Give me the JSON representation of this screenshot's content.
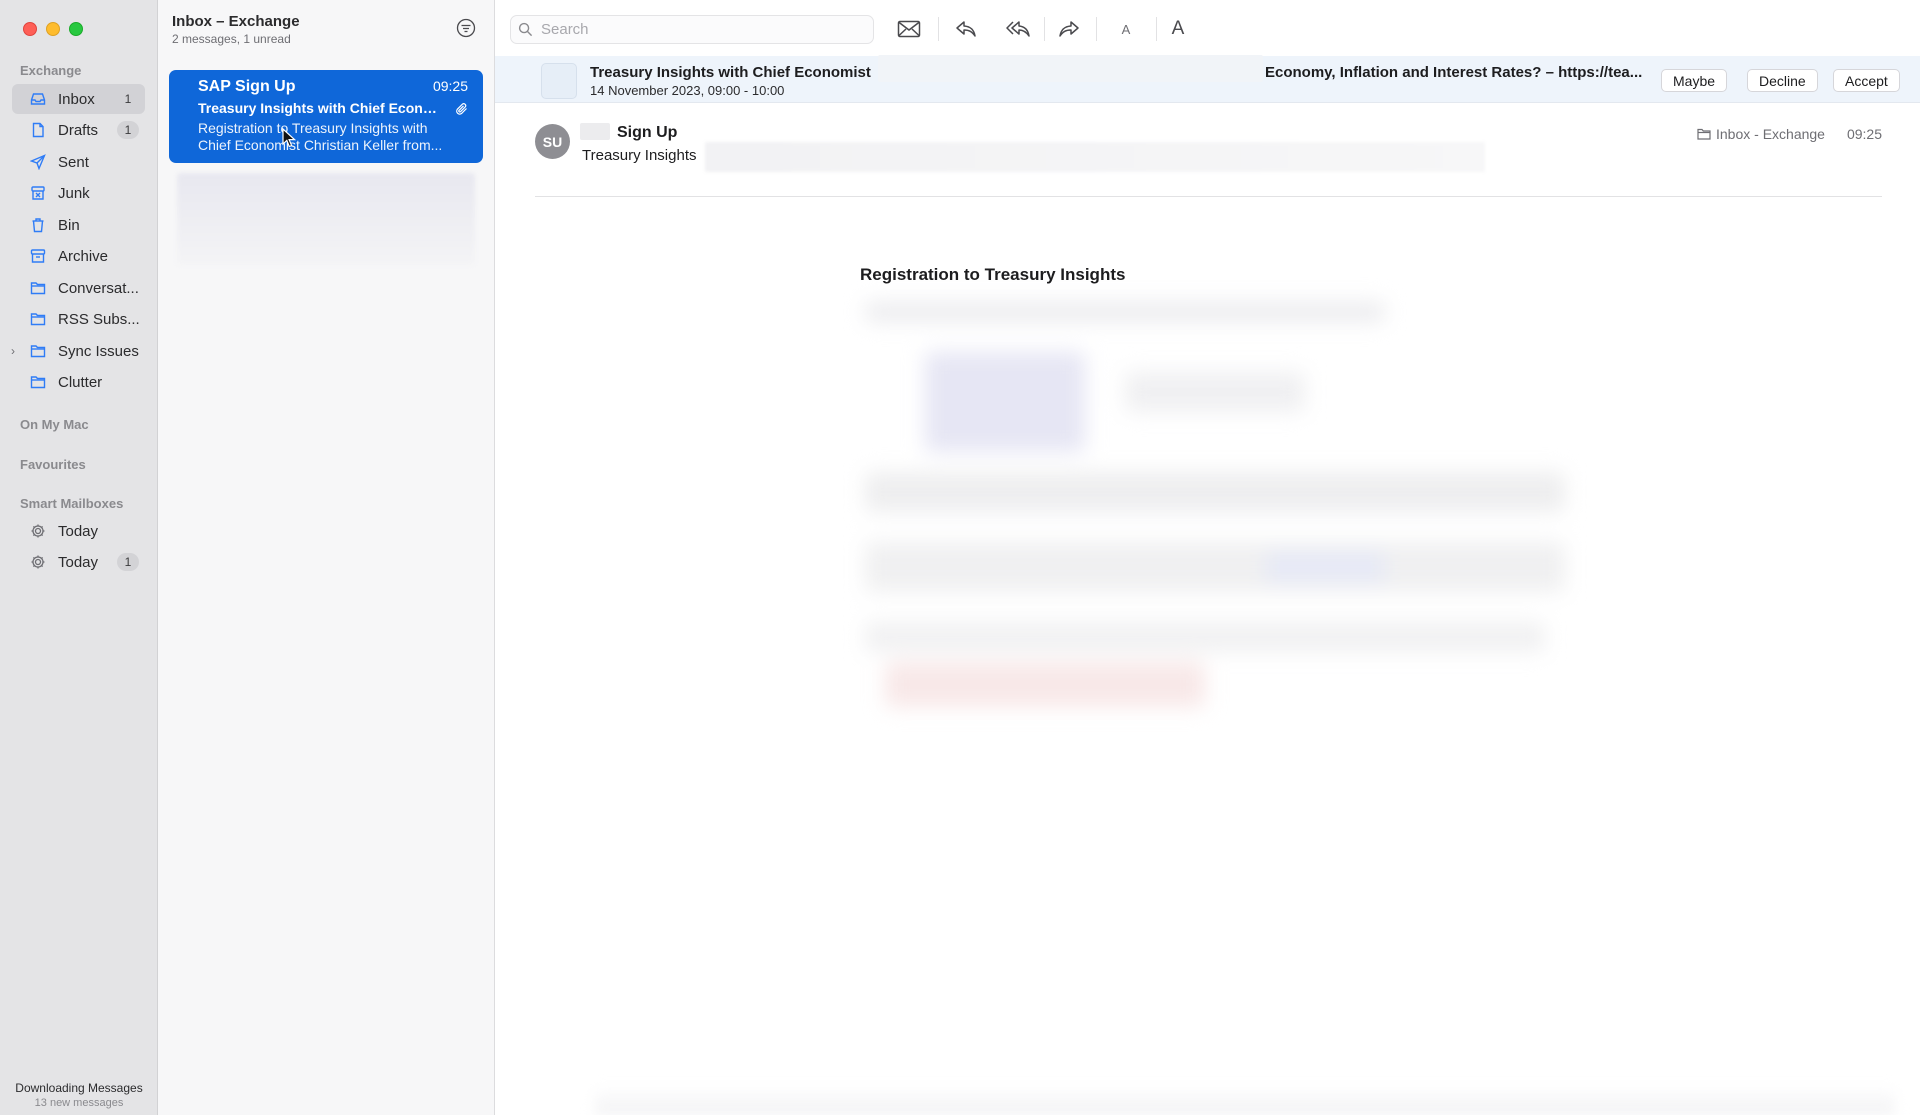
{
  "sidebar": {
    "section_exchange": "Exchange",
    "items": [
      {
        "label": "Inbox",
        "badge": "1"
      },
      {
        "label": "Drafts",
        "badge": "1"
      },
      {
        "label": "Sent"
      },
      {
        "label": "Junk"
      },
      {
        "label": "Bin"
      },
      {
        "label": "Archive"
      },
      {
        "label": "Conversat..."
      },
      {
        "label": "RSS Subs..."
      },
      {
        "label": "Sync Issues"
      },
      {
        "label": "Clutter"
      }
    ],
    "section_on_my_mac": "On My Mac",
    "section_favourites": "Favourites",
    "section_smart": "Smart Mailboxes",
    "smart_items": [
      {
        "label": "Today"
      },
      {
        "label": "Today",
        "badge": "1"
      }
    ],
    "footer_status": "Downloading Messages",
    "footer_count": "13 new messages"
  },
  "message_list": {
    "title": "Inbox – Exchange",
    "subtitle": "2 messages, 1 unread",
    "selected": {
      "sender": "SAP Sign Up",
      "time": "09:25",
      "subject": "Treasury Insights with Chief Econo...",
      "preview": "Registration to Treasury Insights with Chief Economist Christian Keller from..."
    }
  },
  "toolbar": {
    "search_placeholder": "Search",
    "font_small": "A",
    "font_large": "A"
  },
  "invite": {
    "title_start": "Treasury Insights with Chief Economist",
    "title_end": "Economy, Inflation and Interest Rates? – https://tea...",
    "date": "14 November 2023, 09:00 - 10:00",
    "maybe": "Maybe",
    "decline": "Decline",
    "accept": "Accept"
  },
  "message": {
    "avatar_initials": "SU",
    "from": "Sign Up",
    "subject": "Treasury Insights",
    "folder": "Inbox - Exchange",
    "time": "09:25",
    "body_title": "Registration to Treasury Insights"
  },
  "colors": {
    "selection_blue": "#0f67d9",
    "sidebar_bg": "#e4e4e6",
    "icon_blue": "#2f7cf6"
  }
}
